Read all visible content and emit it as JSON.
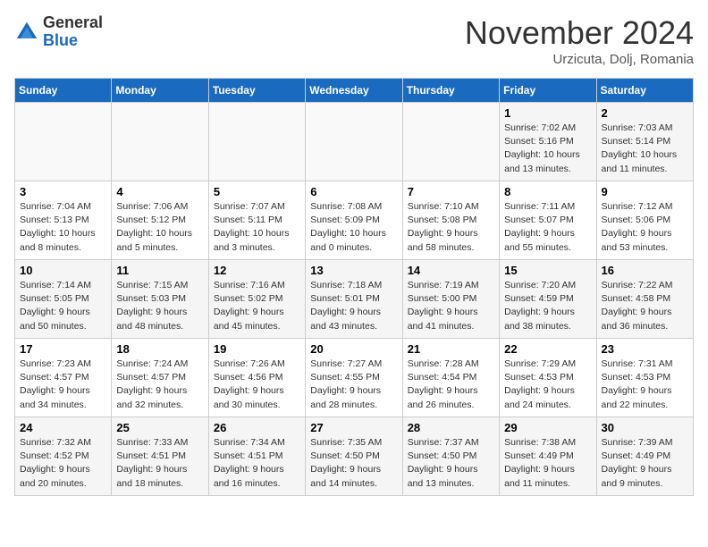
{
  "header": {
    "logo_general": "General",
    "logo_blue": "Blue",
    "month_title": "November 2024",
    "location": "Urzicuta, Dolj, Romania"
  },
  "weekdays": [
    "Sunday",
    "Monday",
    "Tuesday",
    "Wednesday",
    "Thursday",
    "Friday",
    "Saturday"
  ],
  "weeks": [
    [
      {
        "day": "",
        "info": ""
      },
      {
        "day": "",
        "info": ""
      },
      {
        "day": "",
        "info": ""
      },
      {
        "day": "",
        "info": ""
      },
      {
        "day": "",
        "info": ""
      },
      {
        "day": "1",
        "info": "Sunrise: 7:02 AM\nSunset: 5:16 PM\nDaylight: 10 hours and 13 minutes."
      },
      {
        "day": "2",
        "info": "Sunrise: 7:03 AM\nSunset: 5:14 PM\nDaylight: 10 hours and 11 minutes."
      }
    ],
    [
      {
        "day": "3",
        "info": "Sunrise: 7:04 AM\nSunset: 5:13 PM\nDaylight: 10 hours and 8 minutes."
      },
      {
        "day": "4",
        "info": "Sunrise: 7:06 AM\nSunset: 5:12 PM\nDaylight: 10 hours and 5 minutes."
      },
      {
        "day": "5",
        "info": "Sunrise: 7:07 AM\nSunset: 5:11 PM\nDaylight: 10 hours and 3 minutes."
      },
      {
        "day": "6",
        "info": "Sunrise: 7:08 AM\nSunset: 5:09 PM\nDaylight: 10 hours and 0 minutes."
      },
      {
        "day": "7",
        "info": "Sunrise: 7:10 AM\nSunset: 5:08 PM\nDaylight: 9 hours and 58 minutes."
      },
      {
        "day": "8",
        "info": "Sunrise: 7:11 AM\nSunset: 5:07 PM\nDaylight: 9 hours and 55 minutes."
      },
      {
        "day": "9",
        "info": "Sunrise: 7:12 AM\nSunset: 5:06 PM\nDaylight: 9 hours and 53 minutes."
      }
    ],
    [
      {
        "day": "10",
        "info": "Sunrise: 7:14 AM\nSunset: 5:05 PM\nDaylight: 9 hours and 50 minutes."
      },
      {
        "day": "11",
        "info": "Sunrise: 7:15 AM\nSunset: 5:03 PM\nDaylight: 9 hours and 48 minutes."
      },
      {
        "day": "12",
        "info": "Sunrise: 7:16 AM\nSunset: 5:02 PM\nDaylight: 9 hours and 45 minutes."
      },
      {
        "day": "13",
        "info": "Sunrise: 7:18 AM\nSunset: 5:01 PM\nDaylight: 9 hours and 43 minutes."
      },
      {
        "day": "14",
        "info": "Sunrise: 7:19 AM\nSunset: 5:00 PM\nDaylight: 9 hours and 41 minutes."
      },
      {
        "day": "15",
        "info": "Sunrise: 7:20 AM\nSunset: 4:59 PM\nDaylight: 9 hours and 38 minutes."
      },
      {
        "day": "16",
        "info": "Sunrise: 7:22 AM\nSunset: 4:58 PM\nDaylight: 9 hours and 36 minutes."
      }
    ],
    [
      {
        "day": "17",
        "info": "Sunrise: 7:23 AM\nSunset: 4:57 PM\nDaylight: 9 hours and 34 minutes."
      },
      {
        "day": "18",
        "info": "Sunrise: 7:24 AM\nSunset: 4:57 PM\nDaylight: 9 hours and 32 minutes."
      },
      {
        "day": "19",
        "info": "Sunrise: 7:26 AM\nSunset: 4:56 PM\nDaylight: 9 hours and 30 minutes."
      },
      {
        "day": "20",
        "info": "Sunrise: 7:27 AM\nSunset: 4:55 PM\nDaylight: 9 hours and 28 minutes."
      },
      {
        "day": "21",
        "info": "Sunrise: 7:28 AM\nSunset: 4:54 PM\nDaylight: 9 hours and 26 minutes."
      },
      {
        "day": "22",
        "info": "Sunrise: 7:29 AM\nSunset: 4:53 PM\nDaylight: 9 hours and 24 minutes."
      },
      {
        "day": "23",
        "info": "Sunrise: 7:31 AM\nSunset: 4:53 PM\nDaylight: 9 hours and 22 minutes."
      }
    ],
    [
      {
        "day": "24",
        "info": "Sunrise: 7:32 AM\nSunset: 4:52 PM\nDaylight: 9 hours and 20 minutes."
      },
      {
        "day": "25",
        "info": "Sunrise: 7:33 AM\nSunset: 4:51 PM\nDaylight: 9 hours and 18 minutes."
      },
      {
        "day": "26",
        "info": "Sunrise: 7:34 AM\nSunset: 4:51 PM\nDaylight: 9 hours and 16 minutes."
      },
      {
        "day": "27",
        "info": "Sunrise: 7:35 AM\nSunset: 4:50 PM\nDaylight: 9 hours and 14 minutes."
      },
      {
        "day": "28",
        "info": "Sunrise: 7:37 AM\nSunset: 4:50 PM\nDaylight: 9 hours and 13 minutes."
      },
      {
        "day": "29",
        "info": "Sunrise: 7:38 AM\nSunset: 4:49 PM\nDaylight: 9 hours and 11 minutes."
      },
      {
        "day": "30",
        "info": "Sunrise: 7:39 AM\nSunset: 4:49 PM\nDaylight: 9 hours and 9 minutes."
      }
    ]
  ]
}
